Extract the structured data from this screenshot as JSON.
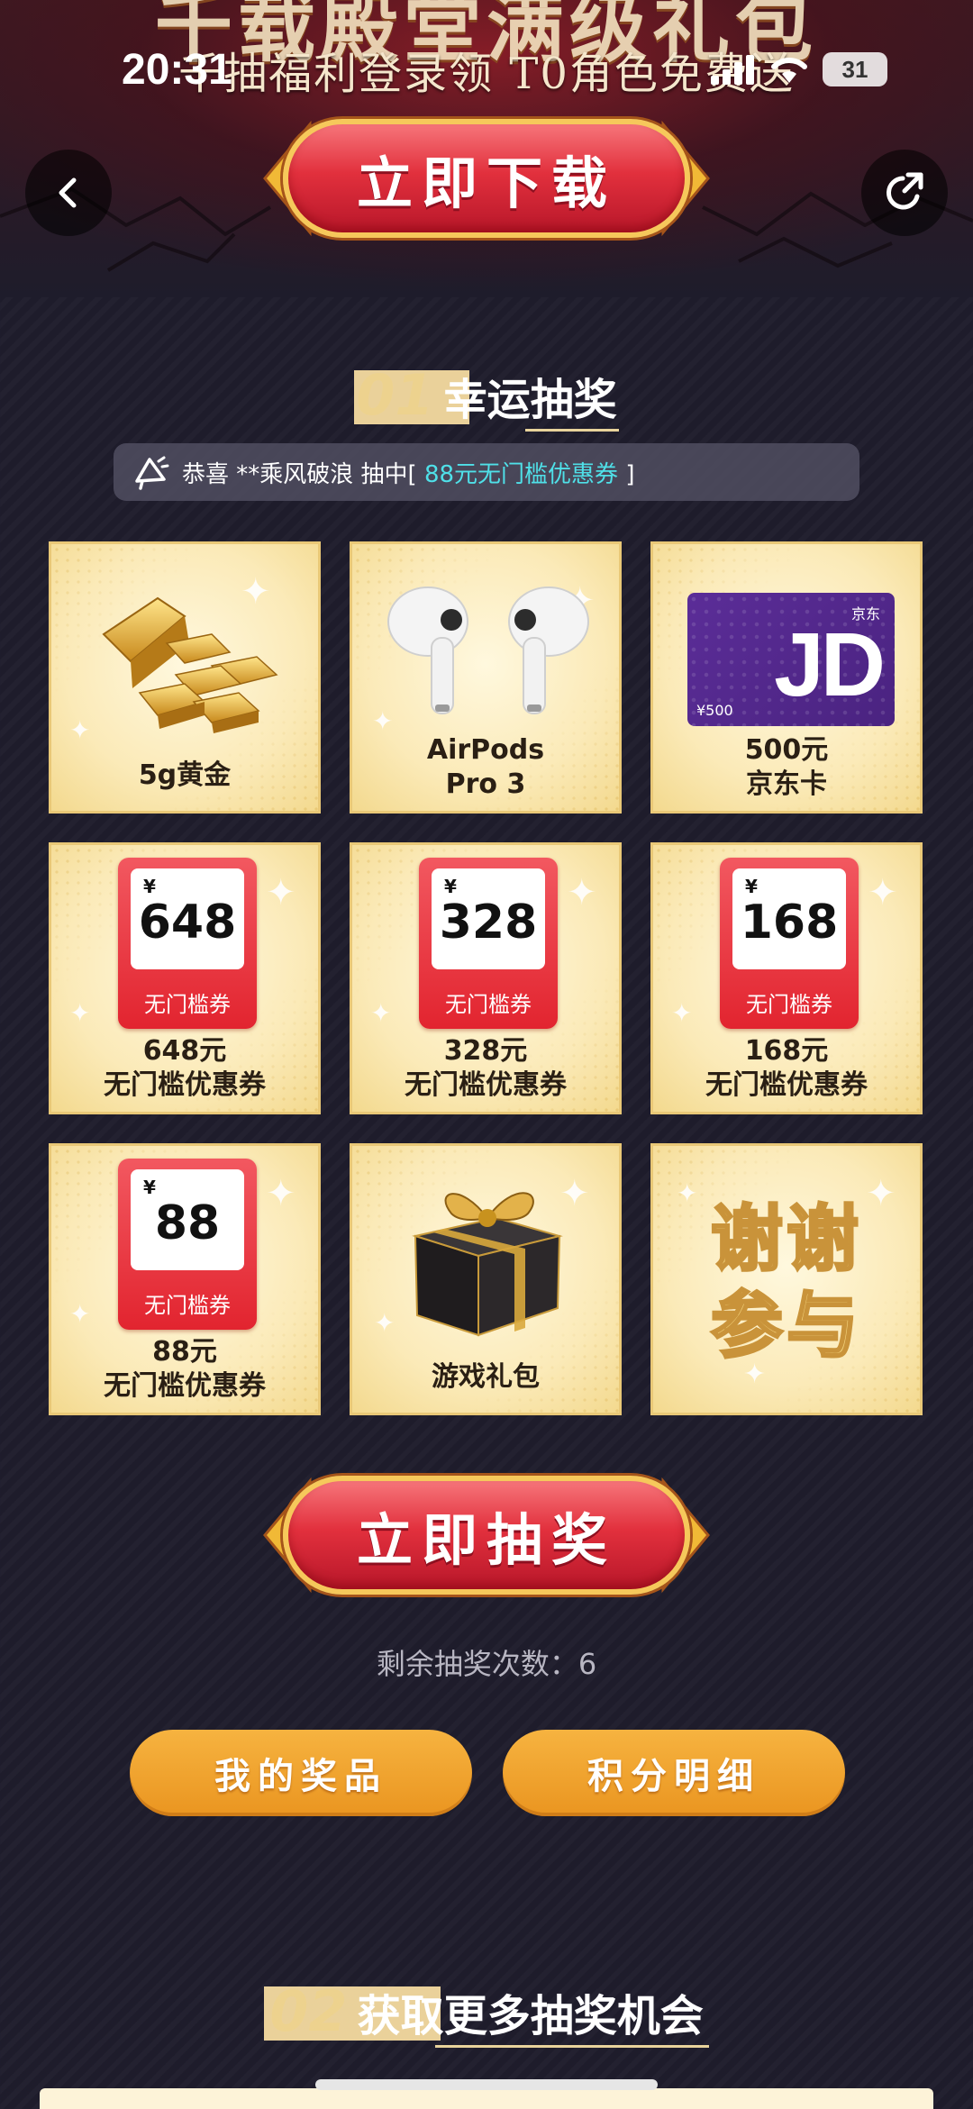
{
  "status_bar": {
    "time": "20:31",
    "battery": "31"
  },
  "hero": {
    "title": "千载殿堂满级礼包",
    "subtitle": "千抽福利登录领 T0角色免费送",
    "download_button": "立即下载"
  },
  "nav": {
    "back_icon": "chevron-left-icon",
    "share_icon": "share-icon"
  },
  "section1": {
    "number": "01",
    "title_a": "幸运",
    "title_b": "抽奖"
  },
  "notice": {
    "icon": "megaphone-icon",
    "prefix": "恭喜 **乘风破浪 抽中[",
    "prize": "88元无门槛优惠券",
    "suffix": "]"
  },
  "prizes": [
    {
      "id": "gold",
      "caption": "5g黄金"
    },
    {
      "id": "airpods",
      "caption_line1": "AirPods",
      "caption_line2": "Pro 3"
    },
    {
      "id": "jd",
      "caption_line1": "500元",
      "caption_line2": "京东卡",
      "card_brand": "京东",
      "card_value": "¥500",
      "card_logo": "JD"
    },
    {
      "id": "c648",
      "coupon_amount": "648",
      "coupon_label": "无门槛券",
      "caption_line1": "648元",
      "caption_line2": "无门槛优惠券"
    },
    {
      "id": "c328",
      "coupon_amount": "328",
      "coupon_label": "无门槛券",
      "caption_line1": "328元",
      "caption_line2": "无门槛优惠券"
    },
    {
      "id": "c168",
      "coupon_amount": "168",
      "coupon_label": "无门槛券",
      "caption_line1": "168元",
      "caption_line2": "无门槛优惠券"
    },
    {
      "id": "c88",
      "coupon_amount": "88",
      "coupon_label": "无门槛券",
      "caption_line1": "88元",
      "caption_line2": "无门槛优惠券"
    },
    {
      "id": "gift",
      "caption": "游戏礼包"
    },
    {
      "id": "thanks",
      "line1": "谢谢",
      "line2": "参与"
    }
  ],
  "coupon_yen": "¥",
  "draw_button": "立即抽奖",
  "remaining": "剩余抽奖次数：6",
  "my_prizes_button": "我的奖品",
  "points_button": "积分明细",
  "section2": {
    "number": "02",
    "title_a": "获取",
    "title_b": "更多抽奖机会"
  },
  "colors": {
    "background": "#1e1c2b",
    "accent_red": "#e2303d",
    "accent_gold": "#f6c85b",
    "orange": "#ea9520",
    "notice_highlight": "#4fe0e8"
  }
}
